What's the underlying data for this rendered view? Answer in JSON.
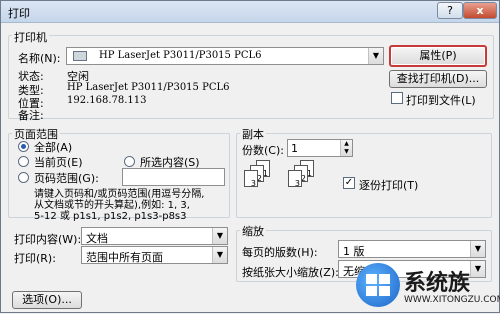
{
  "window": {
    "title": "打印",
    "help_label": "?",
    "close_label": "x"
  },
  "printer": {
    "group_title": "打印机",
    "name_label": "名称(N):",
    "name_value": "HP LaserJet P3011/P3015 PCL6",
    "status_label": "状态:",
    "status_value": "空闲",
    "type_label": "类型:",
    "type_value": "HP LaserJet P3011/P3015 PCL6",
    "location_label": "位置:",
    "location_value": "192.168.78.113",
    "comment_label": "备注:",
    "properties_button": "属性(P)",
    "find_printer_button": "查找打印机(D)...",
    "print_to_file_label": "打印到文件(L)",
    "print_to_file_checked": false
  },
  "page_range": {
    "group_title": "页面范围",
    "all_label": "全部(A)",
    "current_label": "当前页(E)",
    "selection_label": "所选内容(S)",
    "pages_label": "页码范围(G):",
    "pages_value": "",
    "hint_line1": "请键入页码和/或页码范围(用逗号分隔,",
    "hint_line2": "从文档或节的开头算起),例如: 1, 3,",
    "hint_line3": "5-12 或 p1s1, p1s2, p1s3-p8s3",
    "selected": "all"
  },
  "copies": {
    "group_title": "副本",
    "count_label": "份数(C):",
    "count_value": "1",
    "collate_label": "逐份打印(T)",
    "collate_checked": true
  },
  "print_what": {
    "label": "打印内容(W):",
    "value": "文档",
    "print_label": "打印(R):",
    "print_value": "范围中所有页面"
  },
  "zoom": {
    "group_title": "缩放",
    "pages_per_sheet_label": "每页的版数(H):",
    "pages_per_sheet_value": "1 版",
    "scale_label": "按纸张大小缩放(Z):",
    "scale_value": "无缩放"
  },
  "footer": {
    "options_button": "选项(O)..."
  },
  "watermark": {
    "brand": "系统族",
    "url": "WWW.XITONGZU.COM"
  },
  "colors": {
    "highlight_border": "#c73a3a",
    "radio_dot": "#2a5caa"
  }
}
